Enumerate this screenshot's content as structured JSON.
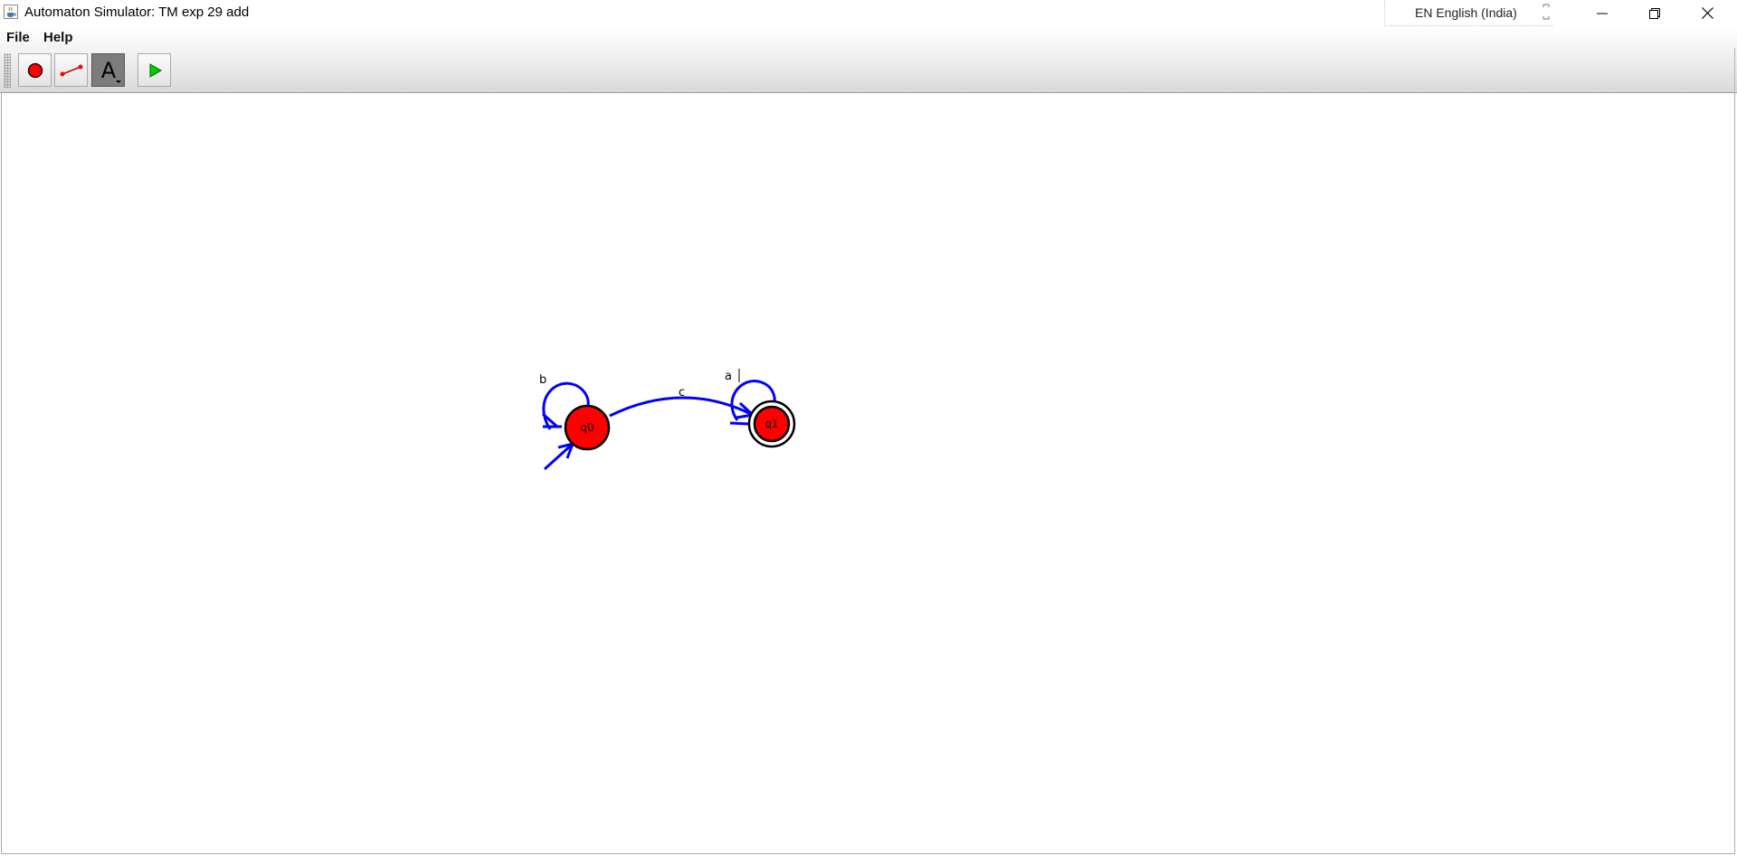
{
  "window": {
    "title": "Automaton Simulator: TM exp 29 add",
    "app_icon": "java-cup-icon",
    "language_indicator": "EN English (India)"
  },
  "menu": {
    "items": [
      {
        "label": "File"
      },
      {
        "label": "Help"
      }
    ]
  },
  "toolbar": {
    "tools": [
      {
        "name": "add-state-tool",
        "icon": "red-circle-icon",
        "selected": false
      },
      {
        "name": "add-transition-tool",
        "icon": "line-segment-icon",
        "selected": false
      },
      {
        "name": "edit-label-tool",
        "icon": "letter-a-icon",
        "glyph": "A",
        "selected": true
      },
      {
        "name": "run-simulation-tool",
        "icon": "green-play-icon",
        "selected": false
      }
    ]
  },
  "automaton": {
    "states": [
      {
        "id": "q0",
        "label": "q0",
        "initial": true,
        "accepting": false,
        "color": "#ff0000"
      },
      {
        "id": "q1",
        "label": "q1",
        "initial": false,
        "accepting": true,
        "color": "#ff0000"
      }
    ],
    "transitions": [
      {
        "from": "q0",
        "to": "q0",
        "label": "b"
      },
      {
        "from": "q0",
        "to": "q1",
        "label": "c"
      },
      {
        "from": "q1",
        "to": "q1",
        "label": "a"
      }
    ],
    "edge_color": "#0000ff"
  }
}
